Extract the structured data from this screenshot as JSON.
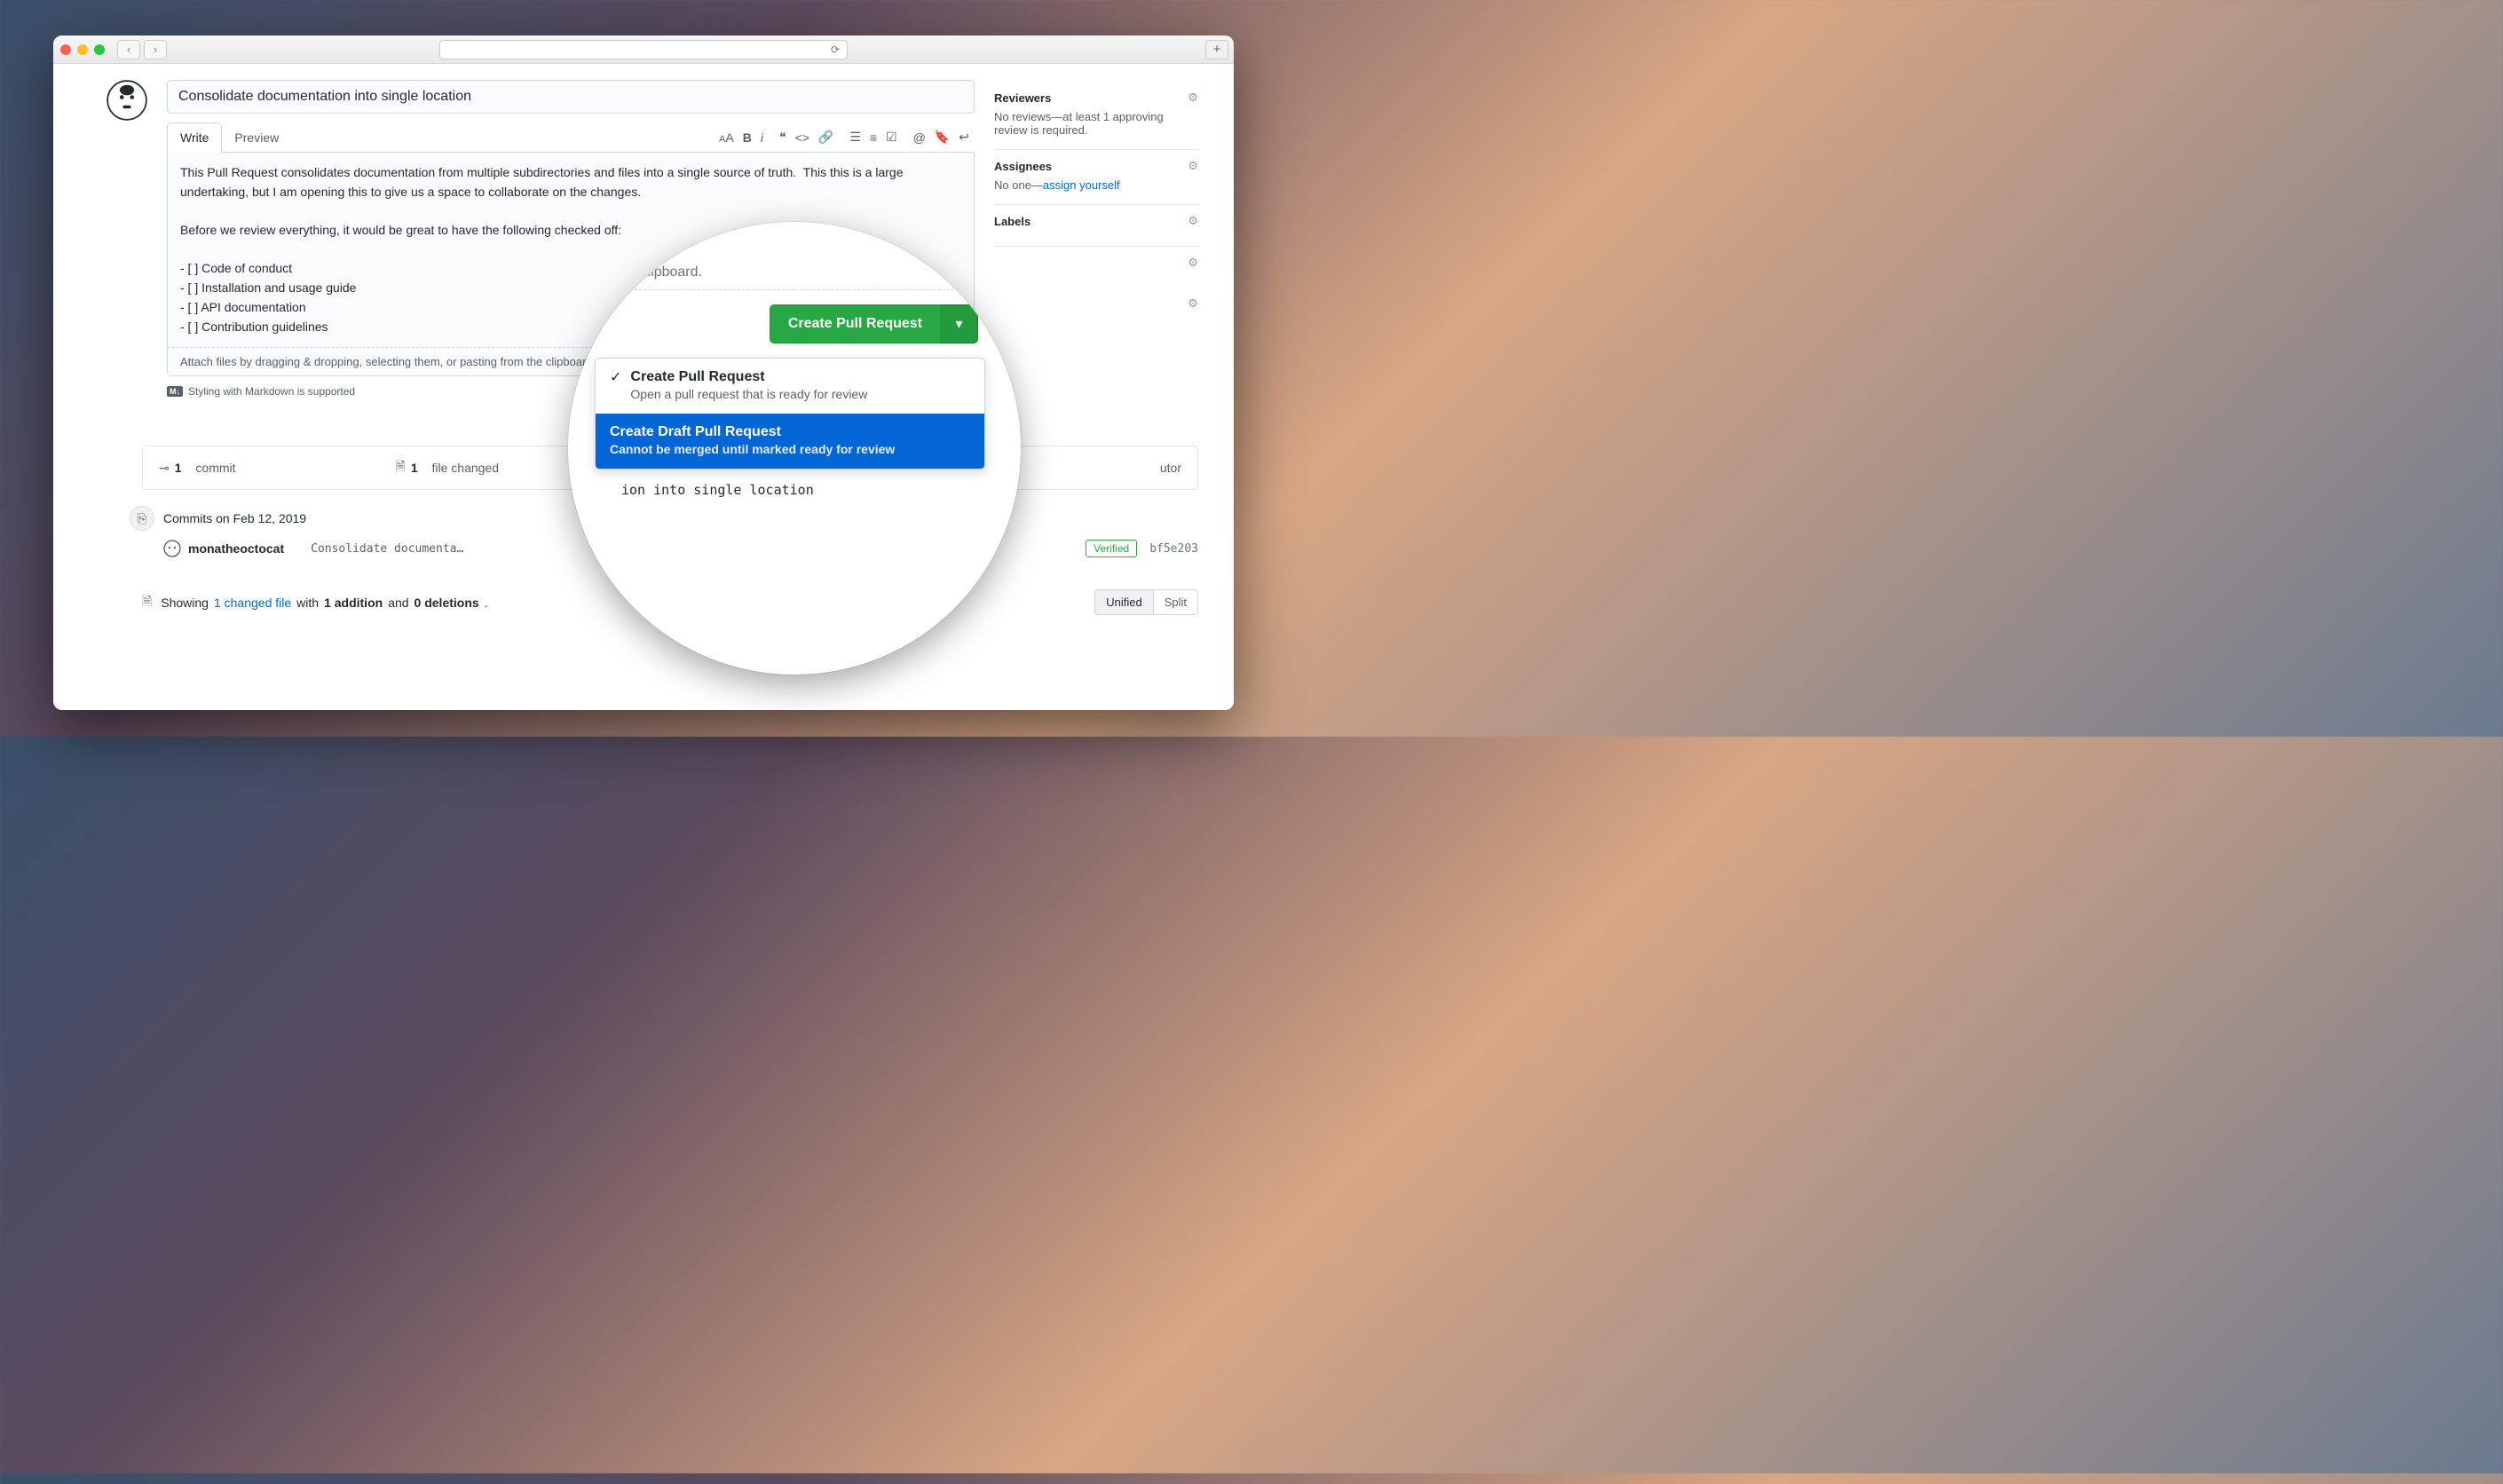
{
  "pr": {
    "title": "Consolidate documentation into single location",
    "body": "This Pull Request consolidates documentation from multiple subdirectories and files into a single source of truth.  This this is a large undertaking, but I am opening this to give us a space to collaborate on the changes.\n\nBefore we review everything, it would be great to have the following checked off:\n\n- [ ] Code of conduct\n- [ ] Installation and usage guide\n- [ ] API documentation\n- [ ] Contribution guidelines",
    "attachHint": "Attach files by dragging & dropping, selecting them, or pasting from the clipboard.",
    "mdHint": "Styling with Markdown is supported",
    "tabs": {
      "write": "Write",
      "preview": "Preview"
    }
  },
  "sidebar": {
    "reviewers": {
      "title": "Reviewers",
      "text": "No reviews—at least 1 approving review is required."
    },
    "assignees": {
      "title": "Assignees",
      "text": "No one—",
      "link": "assign yourself"
    },
    "labels": {
      "title": "Labels"
    }
  },
  "counter": {
    "commits": {
      "n": "1",
      "label": "commit"
    },
    "files": {
      "n": "1",
      "label": "file changed"
    },
    "contribs": {
      "label": "utor"
    }
  },
  "timeline": {
    "header": "Commits on Feb 12, 2019",
    "author": "monatheoctocat",
    "msgFull": "Consolidate documentation into single location",
    "msgTrunc": "Consolidate documenta…",
    "verified": "Verified",
    "sha": "bf5e203"
  },
  "diff": {
    "showing": "Showing",
    "filesLink": "1 changed file",
    "with": "with",
    "adds": "1 addition",
    "and": "and",
    "dels": "0 deletions",
    "unified": "Unified",
    "split": "Split"
  },
  "mag": {
    "clip": ". the clipboard.",
    "btn": "Create Pull Request",
    "item1": {
      "title": "Create Pull Request",
      "sub": "Open a pull request that is ready for review"
    },
    "item2": {
      "title": "Create Draft Pull Request",
      "sub": "Cannot be merged until marked ready for review"
    },
    "commitTail": "ion into single location"
  }
}
